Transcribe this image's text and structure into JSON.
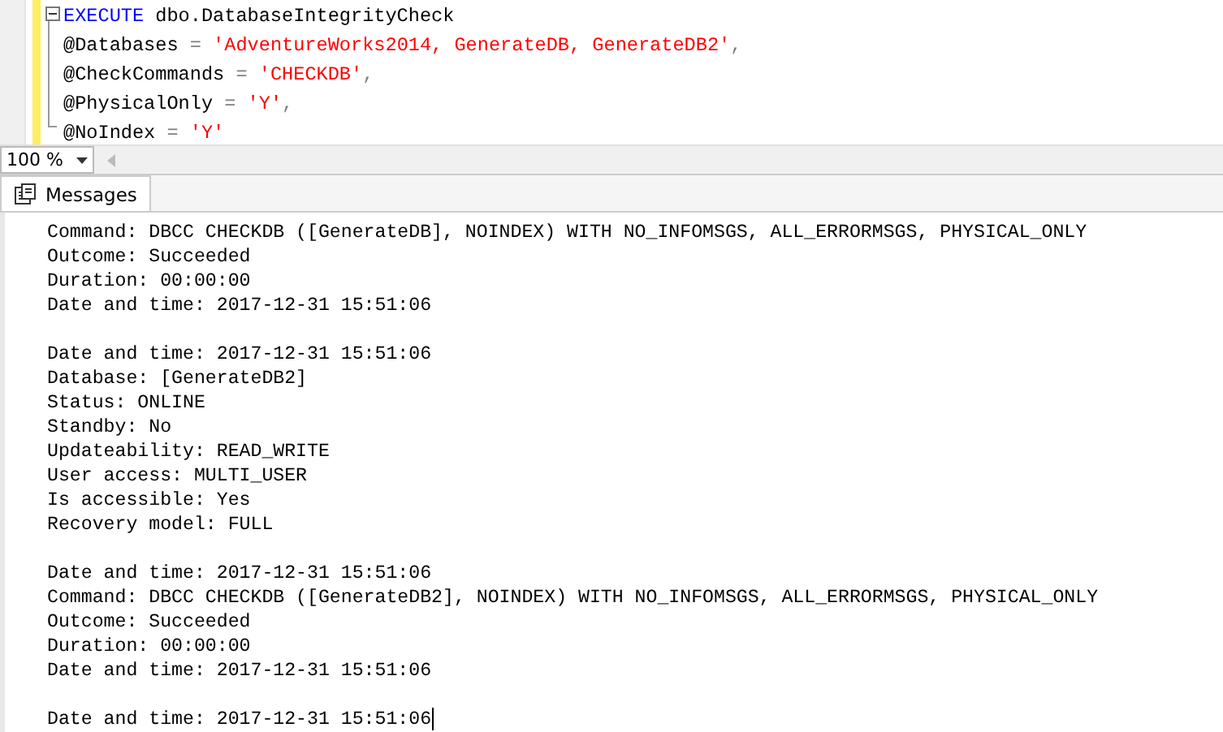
{
  "editor": {
    "code_lines": [
      {
        "tokens": [
          {
            "text": "EXECUTE",
            "kind": "keyword"
          },
          {
            "text": " dbo.DatabaseIntegrityCheck",
            "kind": "plain"
          }
        ]
      },
      {
        "tokens": [
          {
            "text": "@Databases ",
            "kind": "plain"
          },
          {
            "text": "=",
            "kind": "operator"
          },
          {
            "text": " 'AdventureWorks2014, GenerateDB, GenerateDB2'",
            "kind": "string"
          },
          {
            "text": ",",
            "kind": "operator"
          }
        ]
      },
      {
        "tokens": [
          {
            "text": "@CheckCommands ",
            "kind": "plain"
          },
          {
            "text": "=",
            "kind": "operator"
          },
          {
            "text": " 'CHECKDB'",
            "kind": "string"
          },
          {
            "text": ",",
            "kind": "operator"
          }
        ]
      },
      {
        "tokens": [
          {
            "text": "@PhysicalOnly ",
            "kind": "plain"
          },
          {
            "text": "=",
            "kind": "operator"
          },
          {
            "text": " 'Y'",
            "kind": "string"
          },
          {
            "text": ",",
            "kind": "operator"
          }
        ]
      },
      {
        "tokens": [
          {
            "text": "@NoIndex ",
            "kind": "plain"
          },
          {
            "text": "=",
            "kind": "operator"
          },
          {
            "text": " 'Y'",
            "kind": "string"
          }
        ]
      }
    ]
  },
  "zoom": {
    "value": "100 %"
  },
  "tabs": [
    {
      "label": "Messages",
      "selected": true
    }
  ],
  "messages": {
    "blocks": [
      [
        "Command: DBCC CHECKDB ([GenerateDB], NOINDEX) WITH NO_INFOMSGS, ALL_ERRORMSGS, PHYSICAL_ONLY",
        "Outcome: Succeeded",
        "Duration: 00:00:00",
        "Date and time: 2017-12-31 15:51:06"
      ],
      [
        "Date and time: 2017-12-31 15:51:06",
        "Database: [GenerateDB2]",
        "Status: ONLINE",
        "Standby: No",
        "Updateability: READ_WRITE",
        "User access: MULTI_USER",
        "Is accessible: Yes",
        "Recovery model: FULL"
      ],
      [
        "Date and time: 2017-12-31 15:51:06",
        "Command: DBCC CHECKDB ([GenerateDB2], NOINDEX) WITH NO_INFOMSGS, ALL_ERRORMSGS, PHYSICAL_ONLY",
        "Outcome: Succeeded",
        "Duration: 00:00:00",
        "Date and time: 2017-12-31 15:51:06"
      ],
      [
        "Date and time: 2017-12-31 15:51:06"
      ]
    ]
  }
}
